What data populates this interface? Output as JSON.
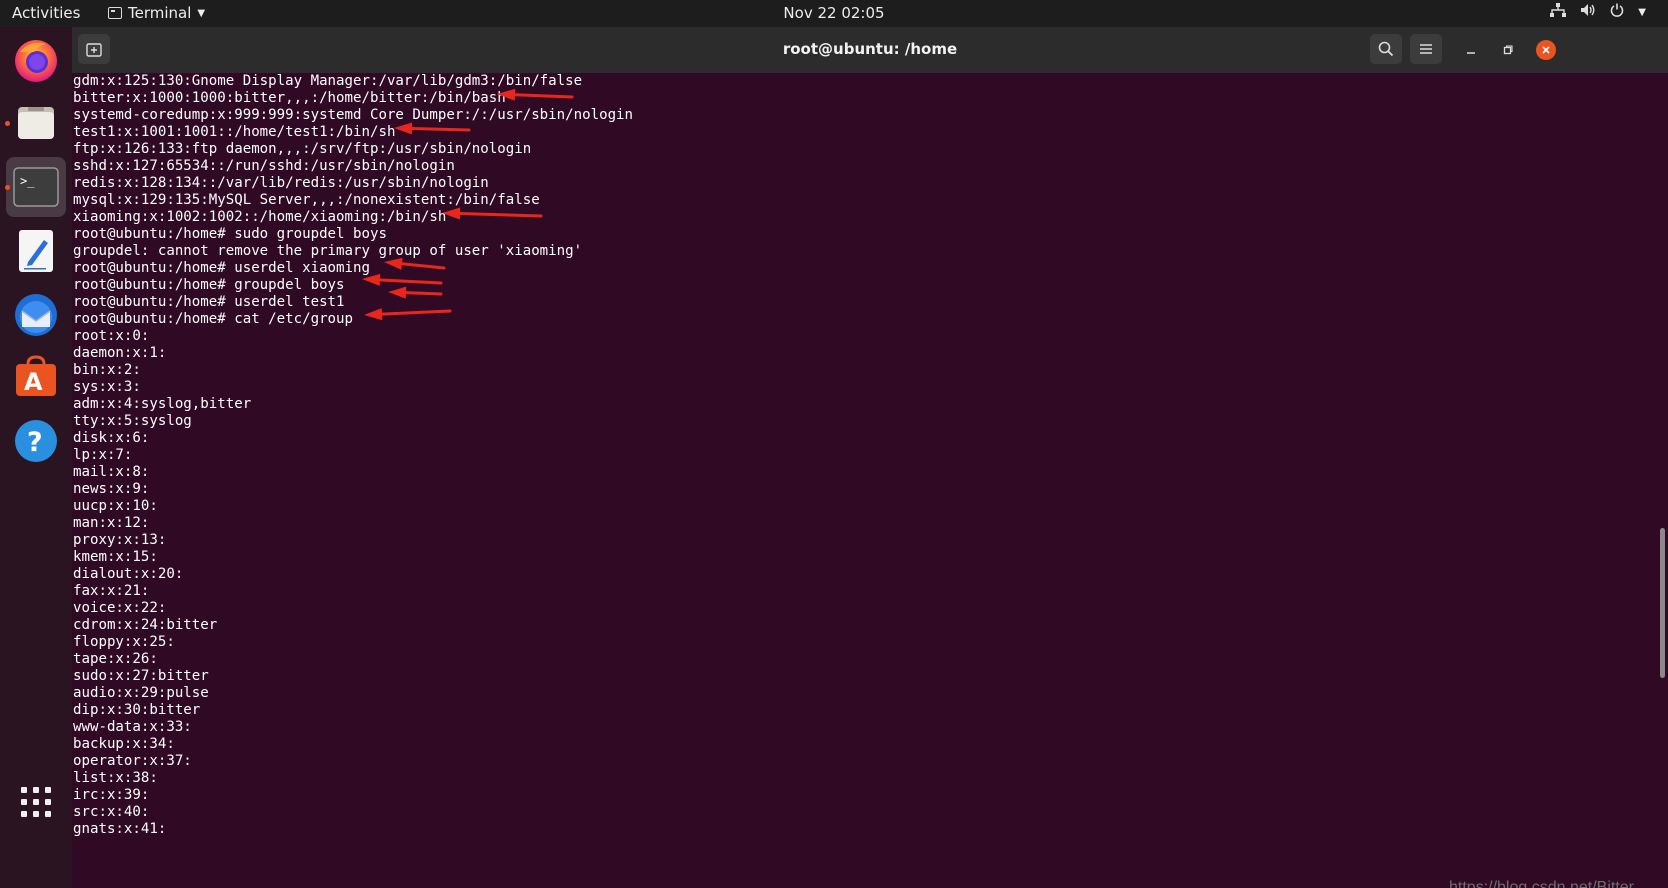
{
  "topbar": {
    "activities": "Activities",
    "app_name": "Terminal",
    "clock": "Nov 22  02:05"
  },
  "dock": {
    "items": [
      {
        "name": "firefox",
        "running": false,
        "active": false
      },
      {
        "name": "files",
        "running": true,
        "active": false
      },
      {
        "name": "terminal",
        "running": true,
        "active": true
      },
      {
        "name": "text-editor",
        "running": false,
        "active": false
      },
      {
        "name": "thunderbird",
        "running": false,
        "active": false
      },
      {
        "name": "software",
        "running": false,
        "active": false
      },
      {
        "name": "help",
        "running": false,
        "active": false
      }
    ]
  },
  "window": {
    "title": "root@ubuntu: /home"
  },
  "terminal": {
    "lines": [
      "gdm:x:125:130:Gnome Display Manager:/var/lib/gdm3:/bin/false",
      "bitter:x:1000:1000:bitter,,,:/home/bitter:/bin/bash",
      "systemd-coredump:x:999:999:systemd Core Dumper:/:/usr/sbin/nologin",
      "test1:x:1001:1001::/home/test1:/bin/sh",
      "ftp:x:126:133:ftp daemon,,,:/srv/ftp:/usr/sbin/nologin",
      "sshd:x:127:65534::/run/sshd:/usr/sbin/nologin",
      "redis:x:128:134::/var/lib/redis:/usr/sbin/nologin",
      "mysql:x:129:135:MySQL Server,,,:/nonexistent:/bin/false",
      "xiaoming:x:1002:1002::/home/xiaoming:/bin/sh",
      "root@ubuntu:/home# sudo groupdel boys",
      "groupdel: cannot remove the primary group of user 'xiaoming'",
      "root@ubuntu:/home# userdel xiaoming",
      "root@ubuntu:/home# groupdel boys",
      "root@ubuntu:/home# userdel test1",
      "root@ubuntu:/home# cat /etc/group",
      "root:x:0:",
      "daemon:x:1:",
      "bin:x:2:",
      "sys:x:3:",
      "adm:x:4:syslog,bitter",
      "tty:x:5:syslog",
      "disk:x:6:",
      "lp:x:7:",
      "mail:x:8:",
      "news:x:9:",
      "uucp:x:10:",
      "man:x:12:",
      "proxy:x:13:",
      "kmem:x:15:",
      "dialout:x:20:",
      "fax:x:21:",
      "voice:x:22:",
      "cdrom:x:24:bitter",
      "floppy:x:25:",
      "tape:x:26:",
      "sudo:x:27:bitter",
      "audio:x:29:pulse",
      "dip:x:30:bitter",
      "www-data:x:33:",
      "backup:x:34:",
      "operator:x:37:",
      "list:x:38:",
      "irc:x:39:",
      "src:x:40:",
      "gnats:x:41:"
    ]
  },
  "annotation_color": "#e8261c",
  "watermark": "https://blog.csdn.net/Bitter___"
}
